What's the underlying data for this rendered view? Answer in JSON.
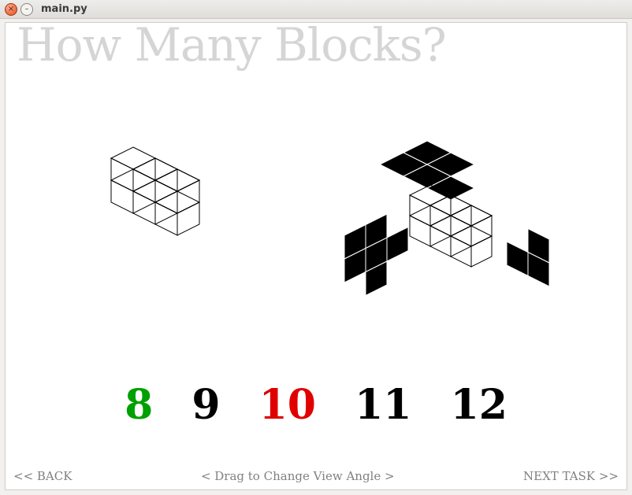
{
  "window": {
    "title": "main.py"
  },
  "heading": "How Many Blocks?",
  "answers": [
    {
      "value": "8",
      "state": "correct"
    },
    {
      "value": "9",
      "state": "normal"
    },
    {
      "value": "10",
      "state": "wrong"
    },
    {
      "value": "11",
      "state": "normal"
    },
    {
      "value": "12",
      "state": "normal"
    }
  ],
  "bottom": {
    "back": "<< BACK",
    "hint": "< Drag to Change View Angle >",
    "next": "NEXT TASK >>"
  },
  "left_structure": {
    "cubes": [
      [
        0,
        0,
        0
      ],
      [
        1,
        0,
        0
      ],
      [
        0,
        1,
        0
      ],
      [
        1,
        1,
        0
      ],
      [
        2,
        1,
        0
      ],
      [
        0,
        1,
        1
      ],
      [
        1,
        1,
        1
      ],
      [
        2,
        1,
        1
      ]
    ]
  },
  "right_structure": {
    "cubes": [
      [
        0,
        0,
        0
      ],
      [
        1,
        0,
        0
      ],
      [
        0,
        1,
        0
      ],
      [
        1,
        1,
        0
      ],
      [
        2,
        1,
        0
      ],
      [
        0,
        1,
        1
      ],
      [
        1,
        1,
        1
      ],
      [
        2,
        1,
        1
      ]
    ],
    "shadow_top": [
      [
        0,
        0
      ],
      [
        1,
        0
      ],
      [
        0,
        1
      ],
      [
        1,
        1
      ],
      [
        2,
        1
      ]
    ],
    "shadow_left": [
      [
        0,
        0
      ],
      [
        1,
        0
      ],
      [
        0,
        1
      ],
      [
        1,
        1
      ],
      [
        2,
        1
      ],
      [
        1,
        2
      ]
    ],
    "shadow_right": [
      [
        0,
        0
      ],
      [
        0,
        1
      ],
      [
        1,
        1
      ]
    ]
  }
}
